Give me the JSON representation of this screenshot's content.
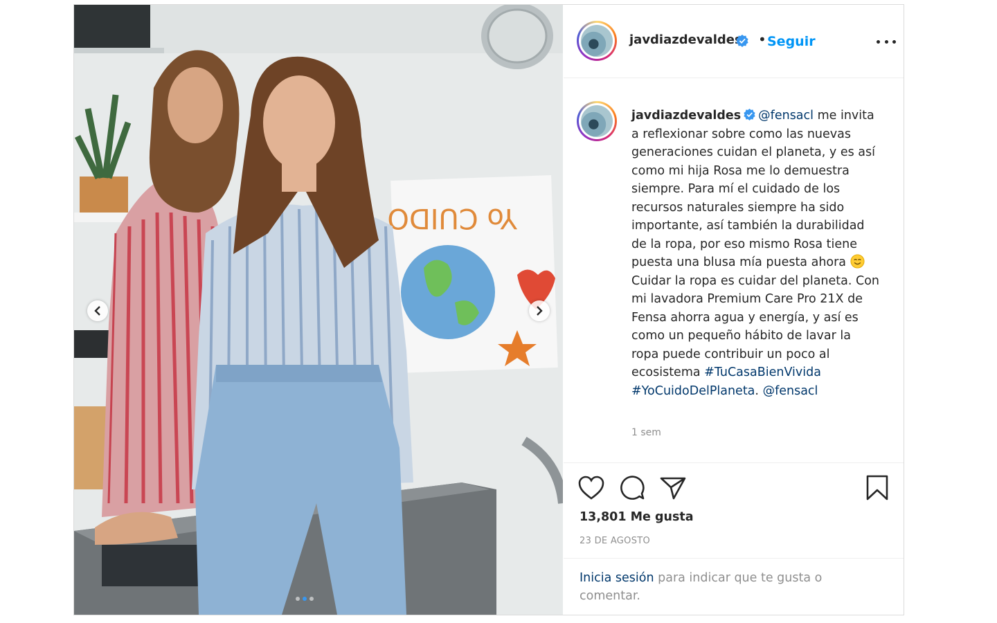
{
  "post": {
    "username": "javdiazdevaldes",
    "separator": "•",
    "follow_label": "Seguir",
    "caption": {
      "username": "javdiazdevaldes",
      "mention": "@fensacl",
      "text_1": " me invita a reflexionar sobre como las nuevas generaciones cuidan el planeta, y es así como mi hija Rosa me lo demuestra siempre. Para mí el cuidado de los recursos naturales siempre ha sido importante, así también la durabilidad de la ropa, por eso mismo Rosa tiene puesta una blusa mía puesta ahora ",
      "text_2": " Cuidar la ropa es cuidar del planeta. Con mi lavadora Premium Care Pro 21X de Fensa ahorra agua y energía, y así es como un pequeño hábito de lavar la ropa puede contribuir un poco al ecosistema ",
      "hashtag_1": "#TuCasaBienVivida",
      "hashtag_2": "#YoCuidoDelPlaneta",
      "mention_end": "@fensacl",
      "emoji": "smiling-face"
    },
    "time_ago": "1 sem",
    "likes": "13,801 Me gusta",
    "date": "23 DE AGOSTO",
    "login": {
      "link": "Inicia sesión",
      "text": " para indicar que te gusta o comentar."
    },
    "carousel": {
      "slides": 3,
      "active_slide": 2
    },
    "icons": {
      "like": "heart-icon",
      "comment": "comment-icon",
      "share": "paper-plane-icon",
      "save": "bookmark-icon",
      "more": "more-options-icon",
      "verified": "verified-badge-icon"
    },
    "colors": {
      "accent": "#0095f6",
      "link": "#00376b",
      "muted": "#8e8e8e",
      "text": "#262626"
    }
  }
}
